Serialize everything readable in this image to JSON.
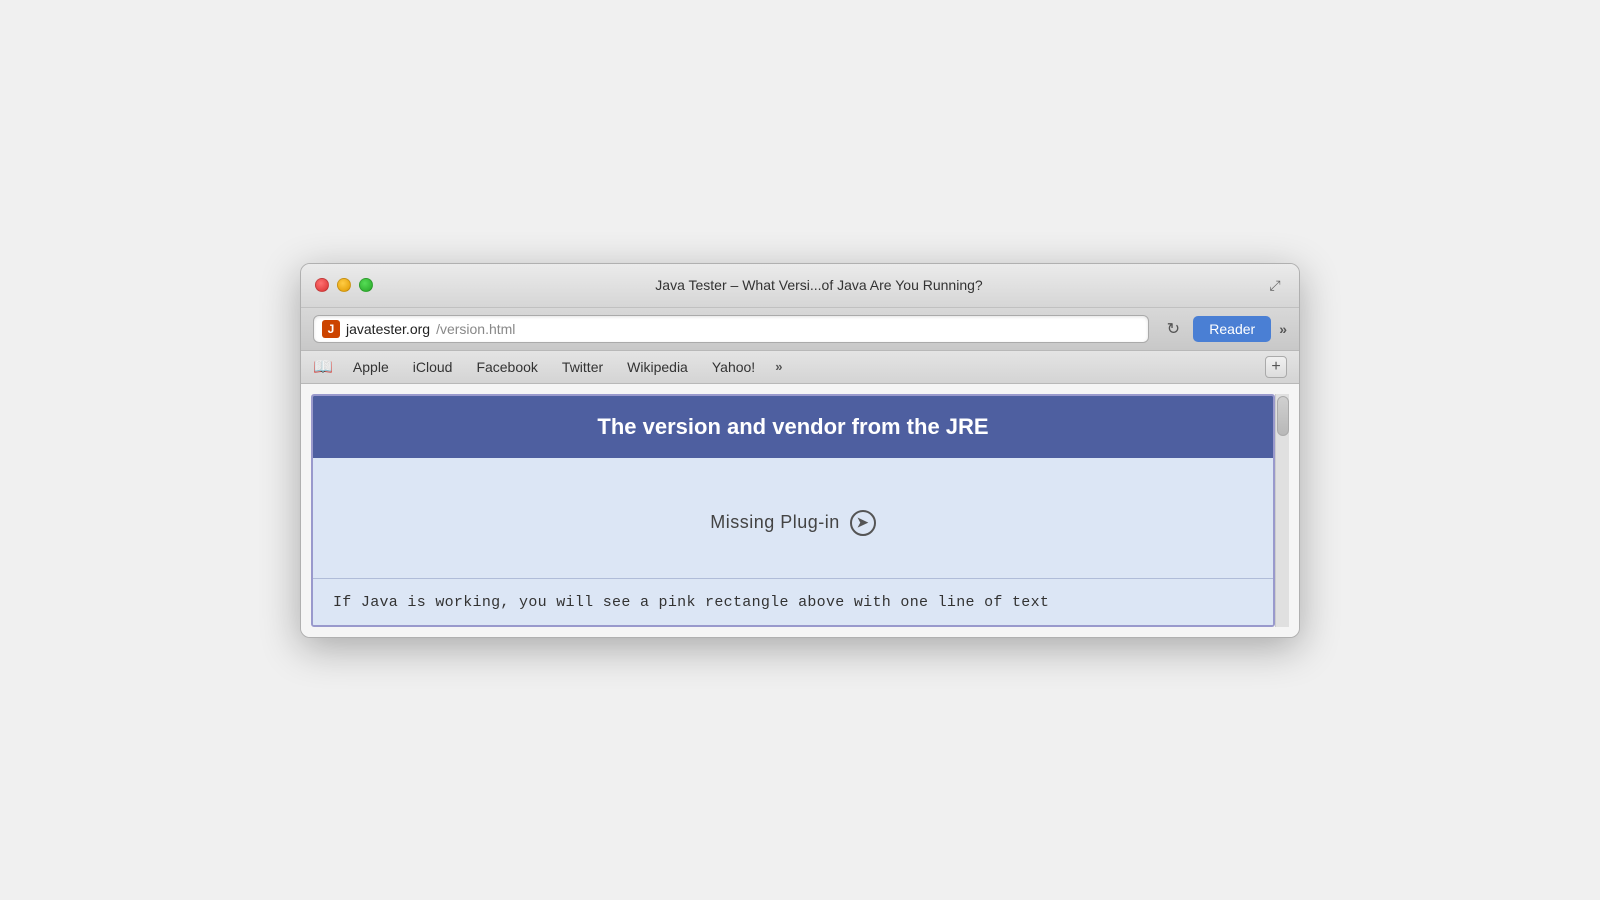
{
  "browser": {
    "title": "Java Tester – What Versi...of Java Are You Running?",
    "traffic_lights": {
      "close_label": "close",
      "minimize_label": "minimize",
      "maximize_label": "maximize"
    },
    "expand_icon": "⤢",
    "address_bar": {
      "favicon_letter": "J",
      "url_domain": "javatester.org",
      "url_path": "/version.html",
      "refresh_icon": "↻",
      "reader_label": "Reader",
      "overflow_icon": "»"
    },
    "bookmarks": {
      "book_icon": "📖",
      "items": [
        {
          "label": "Apple"
        },
        {
          "label": "iCloud"
        },
        {
          "label": "Facebook"
        },
        {
          "label": "Twitter"
        },
        {
          "label": "Wikipedia"
        },
        {
          "label": "Yahoo!"
        }
      ],
      "overflow_label": "»",
      "new_tab_label": "+"
    },
    "page": {
      "header_text": "The version and vendor from the JRE",
      "missing_plugin_text": "Missing Plug-in",
      "missing_plugin_icon": "➤",
      "footer_text": "If Java is working, you will see a pink rectangle above with one line of text"
    }
  }
}
